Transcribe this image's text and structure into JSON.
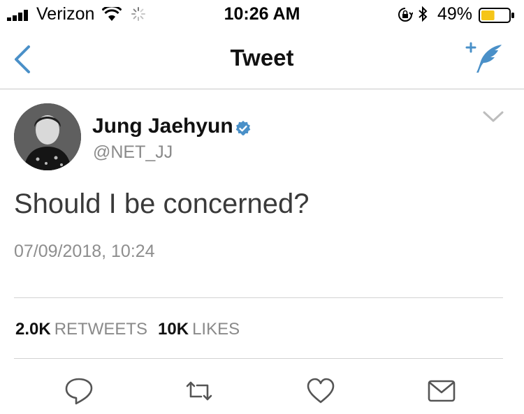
{
  "status_bar": {
    "carrier": "Verizon",
    "time": "10:26 AM",
    "battery_percent": "49%",
    "battery_level": 0.49,
    "icons": [
      "signal-icon",
      "wifi-icon",
      "activity-spinner-icon",
      "orientation-lock-icon",
      "bluetooth-icon",
      "battery-icon"
    ]
  },
  "nav": {
    "title": "Tweet",
    "back_icon": "chevron-left-icon",
    "compose_icon": "compose-tweet-icon"
  },
  "tweet": {
    "display_name": "Jung Jaehyun",
    "handle": "@NET_JJ",
    "verified": true,
    "text": "Should I be concerned?",
    "timestamp": "07/09/2018, 10:24",
    "retweets_count": "2.0K",
    "retweets_label": "RETWEETS",
    "likes_count": "10K",
    "likes_label": "LIKES"
  },
  "actions": [
    "reply-icon",
    "retweet-icon",
    "like-icon",
    "direct-message-icon"
  ],
  "colors": {
    "accent": "#4a90c8",
    "battery_fill": "#f5c518",
    "text_primary": "#111111",
    "text_secondary": "#8a8a8a"
  }
}
